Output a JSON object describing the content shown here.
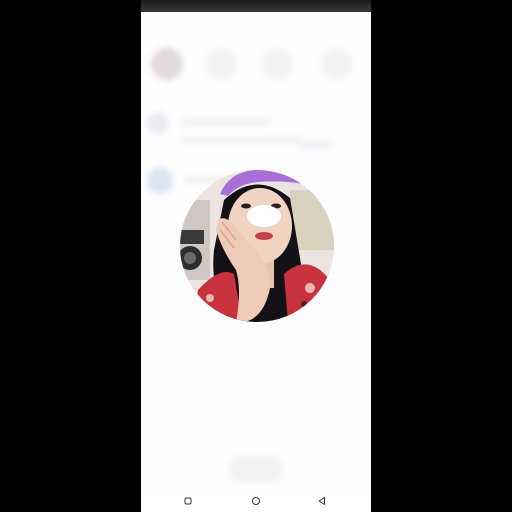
{
  "status_bar": {
    "time": "",
    "icons": ""
  },
  "profile_photo": {
    "alt": "Profile picture"
  },
  "nav_bar": {
    "recents_icon": "square-icon",
    "home_icon": "circle-icon",
    "back_icon": "triangle-back-icon"
  },
  "colors": {
    "page_background": "#000000",
    "screen_background": "#fbf9fc",
    "hat_color": "#a86fd6",
    "garment_color": "#c8323c",
    "hair_color": "#141217"
  }
}
